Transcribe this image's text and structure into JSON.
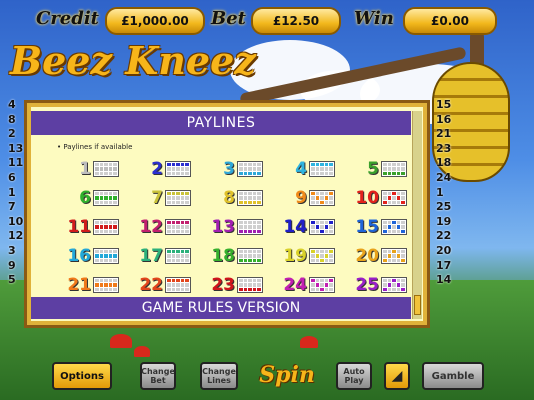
{
  "topbar": {
    "credit_label": "Credit",
    "credit_value": "£1,000.00",
    "bet_label": "Bet",
    "bet_value": "£12.50",
    "win_label": "Win",
    "win_value": "£0.00"
  },
  "logo": "Beez Kneez",
  "left_numbers": [
    "4",
    "8",
    "2",
    "13",
    "11",
    "6",
    "1",
    "7",
    "10",
    "12",
    "3",
    "9",
    "5"
  ],
  "right_numbers": [
    "15",
    "16",
    "21",
    "23",
    "18",
    "24",
    "1",
    "25",
    "19",
    "22",
    "20",
    "17",
    "14"
  ],
  "panel": {
    "title": "PAYLINES",
    "note": "• Paylines if available",
    "footer": "GAME RULES VERSION"
  },
  "paylines": [
    {
      "n": "1",
      "color": "#bdbdbd"
    },
    {
      "n": "2",
      "color": "#2c2fd0"
    },
    {
      "n": "3",
      "color": "#2fa8d8"
    },
    {
      "n": "4",
      "color": "#2fb4e0"
    },
    {
      "n": "5",
      "color": "#3aa02c"
    },
    {
      "n": "6",
      "color": "#2fb02c"
    },
    {
      "n": "7",
      "color": "#c9c23a"
    },
    {
      "n": "8",
      "color": "#e0c22a"
    },
    {
      "n": "9",
      "color": "#f08a1a"
    },
    {
      "n": "10",
      "color": "#e2221c"
    },
    {
      "n": "11",
      "color": "#d01c1c"
    },
    {
      "n": "12",
      "color": "#c2206e"
    },
    {
      "n": "13",
      "color": "#a21fb2"
    },
    {
      "n": "14",
      "color": "#2020c8"
    },
    {
      "n": "15",
      "color": "#1f64d8"
    },
    {
      "n": "16",
      "color": "#23a8d8"
    },
    {
      "n": "17",
      "color": "#2cb07a"
    },
    {
      "n": "18",
      "color": "#36b02c"
    },
    {
      "n": "19",
      "color": "#d9d12a"
    },
    {
      "n": "20",
      "color": "#e8a21a"
    },
    {
      "n": "21",
      "color": "#f07a1a"
    },
    {
      "n": "22",
      "color": "#e2461c"
    },
    {
      "n": "23",
      "color": "#d0141c"
    },
    {
      "n": "24",
      "color": "#c21fb2"
    },
    {
      "n": "25",
      "color": "#9a1fc8"
    }
  ],
  "controls": {
    "options": "Options",
    "change_bet": "Change Bet",
    "change_lines": "Change Lines",
    "spin": "Spin",
    "auto_play": "Auto Play",
    "gamble": "Gamble"
  },
  "colors": {
    "panel_header": "#5d3fa3",
    "accent_gold": "#f2b81c"
  }
}
